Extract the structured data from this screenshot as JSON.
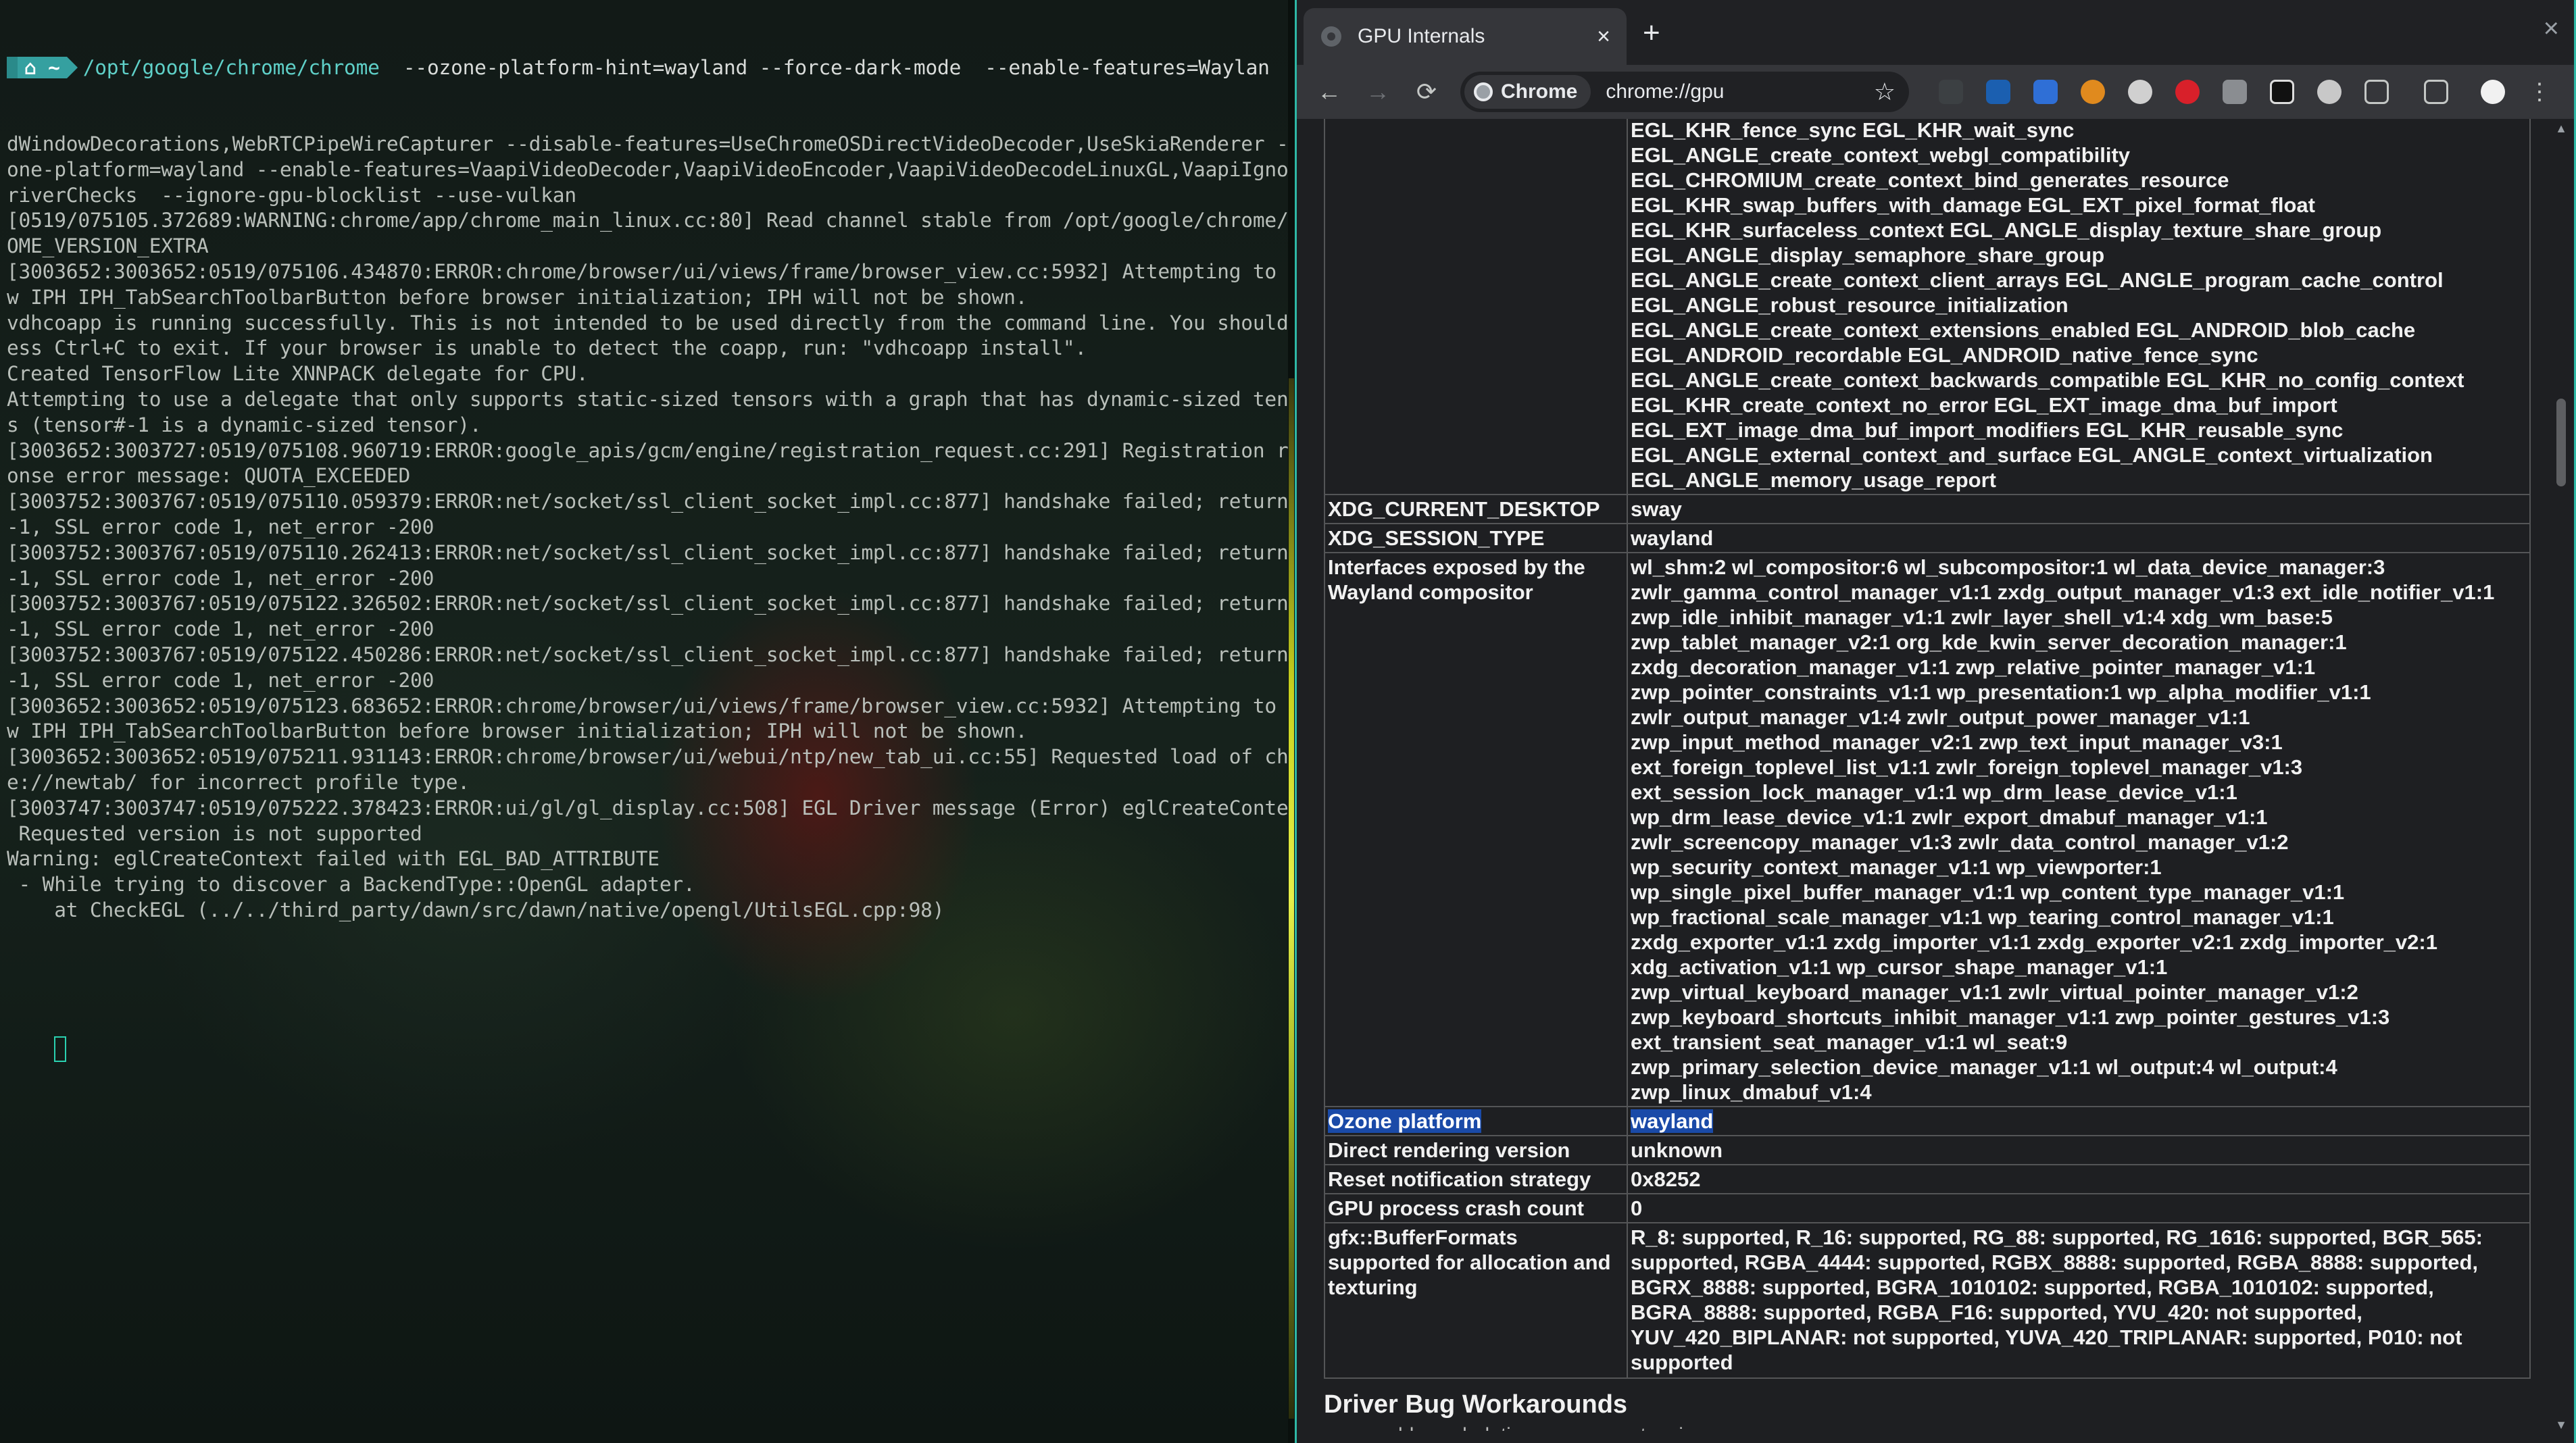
{
  "terminal": {
    "prompt": {
      "segment1": "",
      "segment2": "⌂ ~"
    },
    "command_path": "/opt/google/chrome/chrome",
    "command_args": "  --ozone-platform-hint=wayland --force-dark-mode  --enable-features=Waylan",
    "lines": [
      "dWindowDecorations,WebRTCPipeWireCapturer --disable-features=UseChromeOSDirectVideoDecoder,UseSkiaRenderer --oz",
      "one-platform=wayland --enable-features=VaapiVideoDecoder,VaapiVideoEncoder,VaapiVideoDecodeLinuxGL,VaapiIgnoreD",
      "riverChecks  --ignore-gpu-blocklist --use-vulkan",
      "[0519/075105.372689:WARNING:chrome/app/chrome_main_linux.cc:80] Read channel stable from /opt/google/chrome/CHR",
      "OME_VERSION_EXTRA",
      "[3003652:3003652:0519/075106.434870:ERROR:chrome/browser/ui/views/frame/browser_view.cc:5932] Attempting to sho",
      "w IPH IPH_TabSearchToolbarButton before browser initialization; IPH will not be shown.",
      "vdhcoapp is running successfully. This is not intended to be used directly from the command line. You should pr",
      "ess Ctrl+C to exit. If your browser is unable to detect the coapp, run: \"vdhcoapp install\".",
      "Created TensorFlow Lite XNNPACK delegate for CPU.",
      "Attempting to use a delegate that only supports static-sized tensors with a graph that has dynamic-sized tensor",
      "s (tensor#-1 is a dynamic-sized tensor).",
      "[3003652:3003727:0519/075108.960719:ERROR:google_apis/gcm/engine/registration_request.cc:291] Registration resp",
      "onse error message: QUOTA_EXCEEDED",
      "[3003752:3003767:0519/075110.059379:ERROR:net/socket/ssl_client_socket_impl.cc:877] handshake failed; returned",
      "-1, SSL error code 1, net_error -200",
      "[3003752:3003767:0519/075110.262413:ERROR:net/socket/ssl_client_socket_impl.cc:877] handshake failed; returned",
      "-1, SSL error code 1, net_error -200",
      "[3003752:3003767:0519/075122.326502:ERROR:net/socket/ssl_client_socket_impl.cc:877] handshake failed; returned",
      "-1, SSL error code 1, net_error -200",
      "[3003752:3003767:0519/075122.450286:ERROR:net/socket/ssl_client_socket_impl.cc:877] handshake failed; returned",
      "-1, SSL error code 1, net_error -200",
      "[3003652:3003652:0519/075123.683652:ERROR:chrome/browser/ui/views/frame/browser_view.cc:5932] Attempting to sho",
      "w IPH IPH_TabSearchToolbarButton before browser initialization; IPH will not be shown.",
      "[3003652:3003652:0519/075211.931143:ERROR:chrome/browser/ui/webui/ntp/new_tab_ui.cc:55] Requested load of chrom",
      "e://newtab/ for incorrect profile type.",
      "[3003747:3003747:0519/075222.378423:ERROR:ui/gl/gl_display.cc:508] EGL Driver message (Error) eglCreateContext:",
      " Requested version is not supported",
      "Warning: eglCreateContext failed with EGL_BAD_ATTRIBUTE",
      " - While trying to discover a BackendType::OpenGL adapter.",
      "    at CheckEGL (../../third_party/dawn/src/dawn/native/opengl/UtilsEGL.cpp:98)"
    ]
  },
  "browser": {
    "tab_title": "GPU Internals",
    "tab_close": "×",
    "new_tab": "+",
    "window_close": "×",
    "nav": {
      "back": "←",
      "forward": "→",
      "reload": "⟳"
    },
    "omnibox": {
      "chip_label": "Chrome",
      "url": "chrome://gpu",
      "star": "☆"
    }
  },
  "gpu": {
    "egl_extensions": [
      "EGL_KHR_fence_sync EGL_KHR_wait_sync",
      "EGL_ANGLE_create_context_webgl_compatibility",
      "EGL_CHROMIUM_create_context_bind_generates_resource",
      "EGL_KHR_swap_buffers_with_damage EGL_EXT_pixel_format_float",
      "EGL_KHR_surfaceless_context EGL_ANGLE_display_texture_share_group",
      "EGL_ANGLE_display_semaphore_share_group",
      "EGL_ANGLE_create_context_client_arrays EGL_ANGLE_program_cache_control",
      "EGL_ANGLE_robust_resource_initialization",
      "EGL_ANGLE_create_context_extensions_enabled EGL_ANDROID_blob_cache",
      "EGL_ANDROID_recordable EGL_ANDROID_native_fence_sync",
      "EGL_ANGLE_create_context_backwards_compatible EGL_KHR_no_config_context",
      "EGL_KHR_create_context_no_error EGL_EXT_image_dma_buf_import",
      "EGL_EXT_image_dma_buf_import_modifiers EGL_KHR_reusable_sync",
      "EGL_ANGLE_external_context_and_surface EGL_ANGLE_context_virtualization",
      "EGL_ANGLE_memory_usage_report"
    ],
    "xdg_current_desktop": {
      "key": "XDG_CURRENT_DESKTOP",
      "value": "sway"
    },
    "xdg_session_type": {
      "key": "XDG_SESSION_TYPE",
      "value": "wayland"
    },
    "wayland_interfaces": {
      "key": "Interfaces exposed by the Wayland compositor",
      "values": [
        "wl_shm:2 wl_compositor:6 wl_subcompositor:1 wl_data_device_manager:3",
        "zwlr_gamma_control_manager_v1:1 zxdg_output_manager_v1:3 ext_idle_notifier_v1:1",
        "zwp_idle_inhibit_manager_v1:1 zwlr_layer_shell_v1:4 xdg_wm_base:5",
        "zwp_tablet_manager_v2:1 org_kde_kwin_server_decoration_manager:1",
        "zxdg_decoration_manager_v1:1 zwp_relative_pointer_manager_v1:1",
        "zwp_pointer_constraints_v1:1 wp_presentation:1 wp_alpha_modifier_v1:1",
        "zwlr_output_manager_v1:4 zwlr_output_power_manager_v1:1",
        "zwp_input_method_manager_v2:1 zwp_text_input_manager_v3:1",
        "ext_foreign_toplevel_list_v1:1 zwlr_foreign_toplevel_manager_v1:3",
        "ext_session_lock_manager_v1:1 wp_drm_lease_device_v1:1",
        "wp_drm_lease_device_v1:1 zwlr_export_dmabuf_manager_v1:1",
        "zwlr_screencopy_manager_v1:3 zwlr_data_control_manager_v1:2",
        "wp_security_context_manager_v1:1 wp_viewporter:1",
        "wp_single_pixel_buffer_manager_v1:1 wp_content_type_manager_v1:1",
        "wp_fractional_scale_manager_v1:1 wp_tearing_control_manager_v1:1",
        "zxdg_exporter_v1:1 zxdg_importer_v1:1 zxdg_exporter_v2:1 zxdg_importer_v2:1",
        "xdg_activation_v1:1 wp_cursor_shape_manager_v1:1",
        "zwp_virtual_keyboard_manager_v1:1 zwlr_virtual_pointer_manager_v1:2",
        "zwp_keyboard_shortcuts_inhibit_manager_v1:1 zwp_pointer_gestures_v1:3",
        "ext_transient_seat_manager_v1:1 wl_seat:9",
        "zwp_primary_selection_device_manager_v1:1 wl_output:4 wl_output:4",
        "zwp_linux_dmabuf_v1:4"
      ]
    },
    "ozone_platform": {
      "key": "Ozone platform",
      "value": "wayland"
    },
    "direct_rendering": {
      "key": "Direct rendering version",
      "value": "unknown"
    },
    "reset_strategy": {
      "key": "Reset notification strategy",
      "value": "0x8252"
    },
    "crash_count": {
      "key": "GPU process crash count",
      "value": "0"
    },
    "buffer_formats": {
      "key": "gfx::BufferFormats supported for allocation and texturing",
      "value": "R_8: supported, R_16: supported, RG_88: supported, RG_1616: supported, BGR_565: supported, RGBA_4444: supported, RGBX_8888: supported, RGBA_8888: supported, BGRX_8888: supported, BGRA_1010102: supported, RGBA_1010102: supported, BGRA_8888: supported, RGBA_F16: supported, YVU_420: not supported, YUV_420_BIPLANAR: not supported, YUVA_420_TRIPLANAR: supported, P010: not supported"
    },
    "section_heading": "Driver Bug Workarounds",
    "section_cut_text": "enable_webgl_timer_query_extensions"
  }
}
